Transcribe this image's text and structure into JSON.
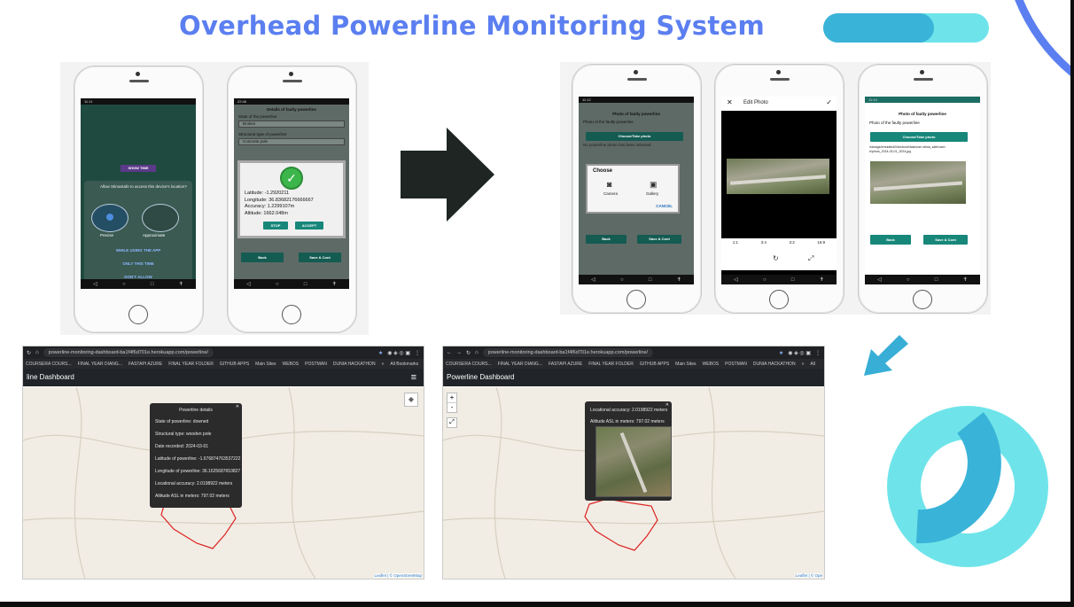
{
  "title": "Overhead Powerline Monitoring System",
  "colors": {
    "title": "#5b7ff0",
    "accent_dark": "#3ab3d8",
    "accent_light": "#6ee4ea",
    "arrow_dark": "#1e2523",
    "arrow_light": "#38aed6"
  },
  "phone1": {
    "status": "11:11",
    "show_time": "SHOW TIME",
    "permission_text": "Allow StimaSafe to access this device's location?",
    "precise": "Precise",
    "approximate": "Approximate",
    "while_using": "WHILE USING THE APP",
    "only_this_time": "ONLY THIS TIME",
    "dont_allow": "DON'T ALLOW"
  },
  "phone2": {
    "status": "22:46",
    "header": "Details of faulty powerline",
    "state_label": "State of the powerline",
    "state_value": "Broken",
    "structural_label": "Structural type of powerline",
    "structural_value": "Concrete pole",
    "latitude": "Latitude: -1.2920211",
    "longitude": "Longitude: 36.83682176666667",
    "accuracy": "Accuracy: 1.2299107m",
    "altitude": "Altitude: 1662.048m",
    "stop": "STOP",
    "accept": "ACCEPT",
    "back": "Back",
    "save_cont": "Save & Cont"
  },
  "phone3": {
    "status": "11:12",
    "header": "Photo of faulty powerline",
    "photo_label": "Photo of the faulty powerline",
    "choose_btn": "Choose/Take photo",
    "no_photo": "No powerline photo has been selected",
    "choose": "Choose",
    "camera": "Camera",
    "gallery": "Gallery",
    "cancel": "CANCEL",
    "back": "Back",
    "save_cont": "Save & Cont"
  },
  "phone4": {
    "header": "Edit Photo",
    "ratios": [
      "1:1",
      "3:4",
      "3:2",
      "16:9"
    ]
  },
  "phone5": {
    "status": "11:14",
    "header": "Photo of faulty powerline",
    "photo_label": "Photo of the faulty powerline",
    "choose_btn": "Choose/Take photo",
    "path": "/storage/emulated/0/Android/data/com.stima_safe/cache/photo_2024-03-01_2024.jpg",
    "back": "Back",
    "save_cont": "Save & Cont"
  },
  "browser1": {
    "url": "powerline-monitoring-dashboard-ba1f4f6d701e.herokuapp.com/powerline/",
    "bookmarks": [
      "COURSERA COURS...",
      "FINAL YEAR DIANG...",
      "FASTAPI AZURE",
      "FINAL YEAR FOLDER",
      "GITHUB APPS",
      "Main Sites",
      "WEBOS",
      "POSTMAN",
      "DUNIA HACKATHON",
      "»",
      "All Bookmarks"
    ],
    "dashboard": "line Dashboard",
    "popup_title": "Powerline details",
    "details": [
      "State of powerline: downed",
      "Structural type: wooden pole",
      "Date recorded: 2024-03-01",
      "Latitude of powerline: -1.676874763537222",
      "Longitude of powerline: 36.1625687653827",
      "Locational accuracy: 2.0198922 meters",
      "Altitude ASL in meters: 797.02 meters"
    ],
    "attribution": "Leaflet | © OpenStreetMap"
  },
  "browser2": {
    "url": "powerline-monitoring-dashboard-ba1f4f6d701e.herokuapp.com/powerline/",
    "bookmarks": [
      "COURSERA COURS...",
      "FINAL YEAR DIANG...",
      "FASTAPI AZURE",
      "FINAL YEAR FOLDER",
      "GITHUB APPS",
      "Main Sites",
      "WEBOS",
      "POSTMAN",
      "DUNIA HACKATHON",
      "»",
      "All"
    ],
    "dashboard": "Powerline Dashboard",
    "accuracy": "Locational accuracy: 2.0198922 meters",
    "altitude": "Altitude ASL in meters: 797.02 meters",
    "zoom_in": "+",
    "zoom_out": "-",
    "attribution": "Leaflet | © Ope"
  }
}
